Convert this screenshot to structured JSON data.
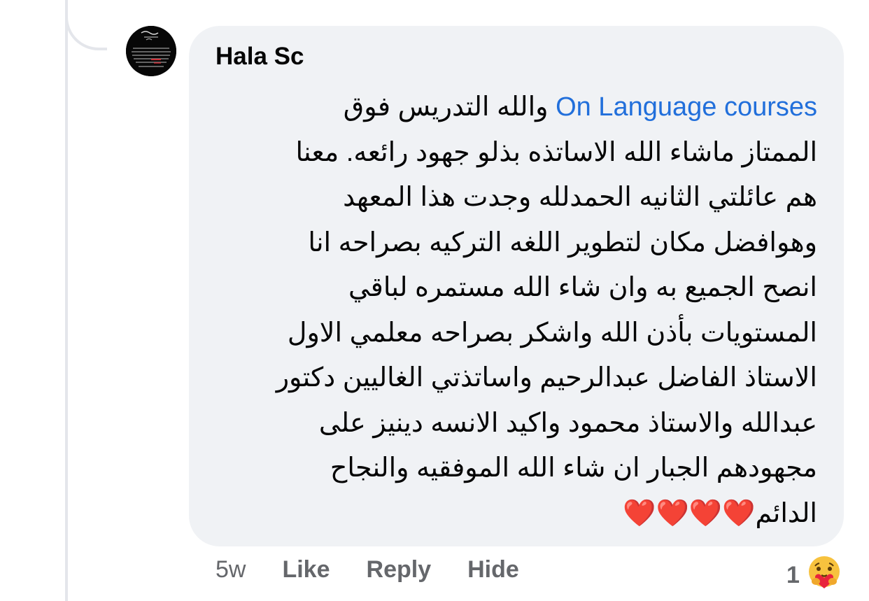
{
  "comment": {
    "author": "Hala Sc",
    "mention": "On Language courses",
    "first_line_rest": " والله التدريس فوق",
    "lines": [
      "الممتاز ماشاء الله الاساتذه بذلو جهود رائعه. معنا",
      "هم عائلتي الثانيه الحمدلله وجدت هذا المعهد",
      "وهوافضل مكان لتطوير اللغه التركيه بصراحه انا",
      "انصح الجميع به وان شاء الله مستمره لباقي",
      "المستويات بأذن الله واشكر بصراحه معلمي الاول",
      "الاستاذ الفاضل عبدالرحيم واساتذتي الغاليين دكتور",
      "عبدالله والاستاذ محمود واكيد الانسه دينيز على",
      "مجهودهم الجبار ان شاء الله الموفقيه والنجاح"
    ],
    "last_line": "الدائم",
    "hearts": "❤️❤️❤️❤️"
  },
  "actions": {
    "time": "5w",
    "like": "Like",
    "reply": "Reply",
    "hide": "Hide"
  },
  "reactions": {
    "count": "1",
    "icon": "care-reaction-icon"
  },
  "colors": {
    "bubble": "#f0f2f5",
    "mention": "#216fdb",
    "meta_text": "#65676b",
    "heart": "#e0102b"
  }
}
